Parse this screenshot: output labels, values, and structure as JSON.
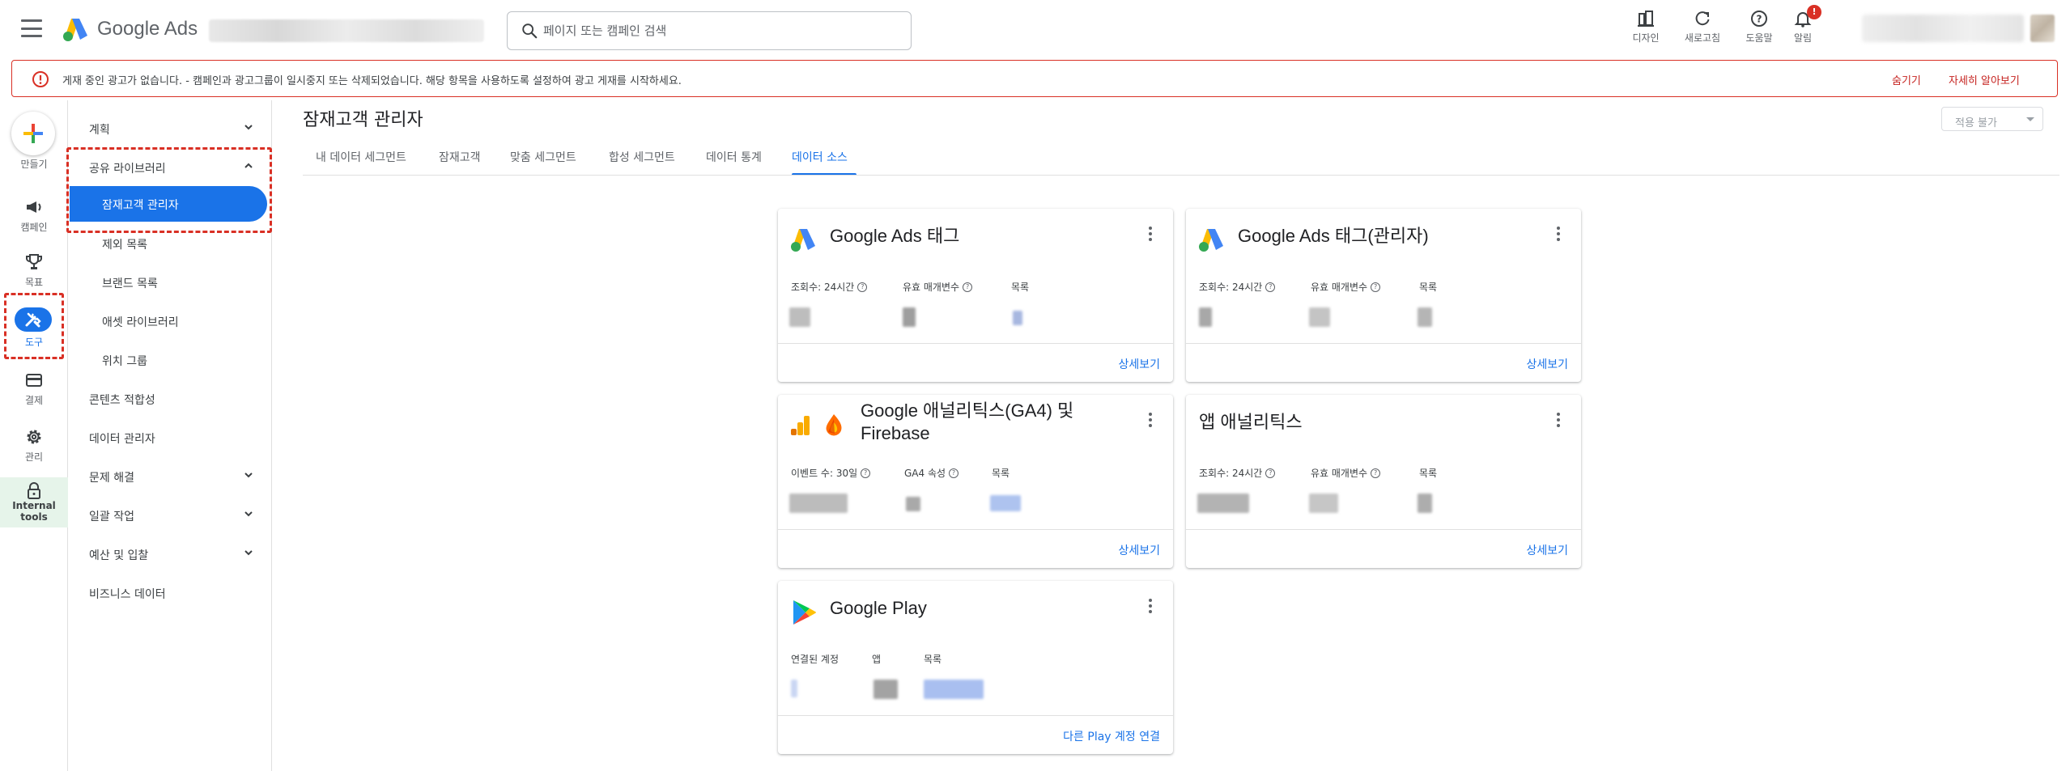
{
  "header": {
    "product_name": "Google Ads",
    "search_placeholder": "페이지 또는 캠페인 검색",
    "actions": {
      "design": "디자인",
      "refresh": "새로고침",
      "help": "도움말",
      "notifications": "알림"
    },
    "notification_badge": "!"
  },
  "banner": {
    "message": "게재 중인 광고가 없습니다. - 캠페인과 광고그룹이 일시중지 또는 삭제되었습니다. 해당 항목을 사용하도록 설정하여 광고 게재를 시작하세요.",
    "hide_label": "숨기기",
    "learn_more_label": "자세히 알아보기"
  },
  "rail": {
    "create": "만들기",
    "campaigns": "캠페인",
    "goals": "목표",
    "tools": "도구",
    "billing": "결제",
    "admin": "관리",
    "internal_tools": "Internal tools"
  },
  "subnav": {
    "planning": "계획",
    "shared_library": "공유 라이브러리",
    "audience_manager": "잠재고객 관리자",
    "exclusion_lists": "제외 목록",
    "brand_lists": "브랜드 목록",
    "asset_library": "애셋 라이브러리",
    "location_groups": "위치 그룹",
    "content_suitability": "콘텐츠 적합성",
    "data_manager": "데이터 관리자",
    "troubleshooting": "문제 해결",
    "bulk_actions": "일괄 작업",
    "budgets_bidding": "예산 및 입찰",
    "business_data": "비즈니스 데이터"
  },
  "main": {
    "title": "잠재고객 관리자",
    "apply_label": "적용 불가",
    "tabs": [
      {
        "label": "내 데이터 세그먼트"
      },
      {
        "label": "잠재고객"
      },
      {
        "label": "맞춤 세그먼트"
      },
      {
        "label": "합성 세그먼트"
      },
      {
        "label": "데이터 통계"
      },
      {
        "label": "데이터 소스"
      }
    ],
    "active_tab": "데이터 소스"
  },
  "cards": [
    {
      "title": "Google Ads 태그",
      "metrics": [
        "조회수: 24시간",
        "유효 매개변수",
        "목록"
      ],
      "action": "상세보기"
    },
    {
      "title": "Google Ads 태그(관리자)",
      "metrics": [
        "조회수: 24시간",
        "유효 매개변수",
        "목록"
      ],
      "action": "상세보기"
    },
    {
      "title_line1": "Google 애널리틱스(GA4) 및",
      "title_line2": "Firebase",
      "metrics": [
        "이벤트 수: 30일",
        "GA4 속성",
        "목록"
      ],
      "action": "상세보기"
    },
    {
      "title": "앱 애널리틱스",
      "metrics": [
        "조회수: 24시간",
        "유효 매개변수",
        "목록"
      ],
      "action": "상세보기"
    },
    {
      "title": "Google Play",
      "metrics": [
        "연결된 계정",
        "앱",
        "목록"
      ],
      "action": "다른 Play 계정 연결"
    }
  ],
  "colors": {
    "accent": "#1a73e8",
    "error": "#d93025",
    "internal_bg": "#e6f4ea"
  }
}
